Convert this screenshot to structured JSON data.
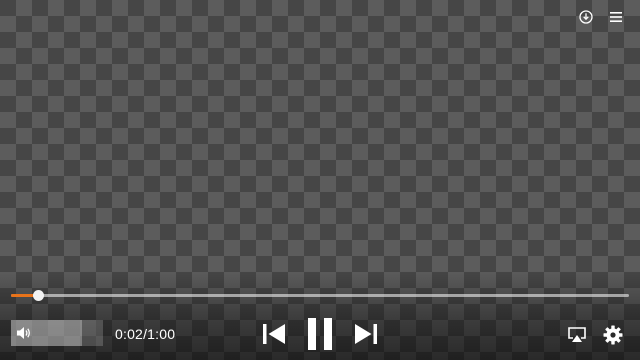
{
  "player": {
    "current_time": "0:02",
    "duration": "1:00",
    "time_separator": "/",
    "progress_fraction": 0.044,
    "volume_fraction": 0.77,
    "accent_color": "#e8731a",
    "checker_colors": [
      "#464646",
      "#5c5c5c"
    ]
  },
  "top_controls": {
    "icons": [
      "download-icon",
      "menu-icon"
    ]
  },
  "bottom_controls": {
    "icons": [
      "volume-icon",
      "previous-icon",
      "pause-icon",
      "next-icon",
      "airplay-icon",
      "settings-icon"
    ]
  }
}
